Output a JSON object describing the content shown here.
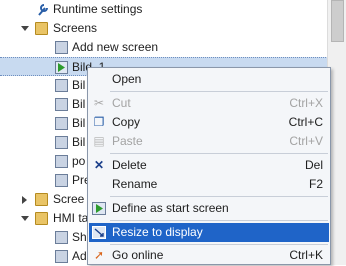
{
  "tree": {
    "runtime_settings": "Runtime settings",
    "screens": "Screens",
    "add_new_screen": "Add new screen",
    "bild_1": "Bild_1",
    "bil_a": "Bil",
    "bil_b": "Bil",
    "bil_c": "Bil",
    "bil_d": "Bil",
    "po": "po",
    "pre": "Pre",
    "scree": "Scree",
    "hmi_ta": "HMI ta",
    "sh": "Sh",
    "ad": "Ad"
  },
  "menu": {
    "open": "Open",
    "cut": "Cut",
    "cut_sc": "Ctrl+X",
    "copy": "Copy",
    "copy_sc": "Ctrl+C",
    "paste": "Paste",
    "paste_sc": "Ctrl+V",
    "delete": "Delete",
    "delete_sc": "Del",
    "rename": "Rename",
    "rename_sc": "F2",
    "define_start": "Define as start screen",
    "resize": "Resize to display",
    "go_online": "Go online",
    "go_online_sc": "Ctrl+K"
  },
  "colors": {
    "highlight": "#1f64c8",
    "selection": "#c8daf0"
  }
}
